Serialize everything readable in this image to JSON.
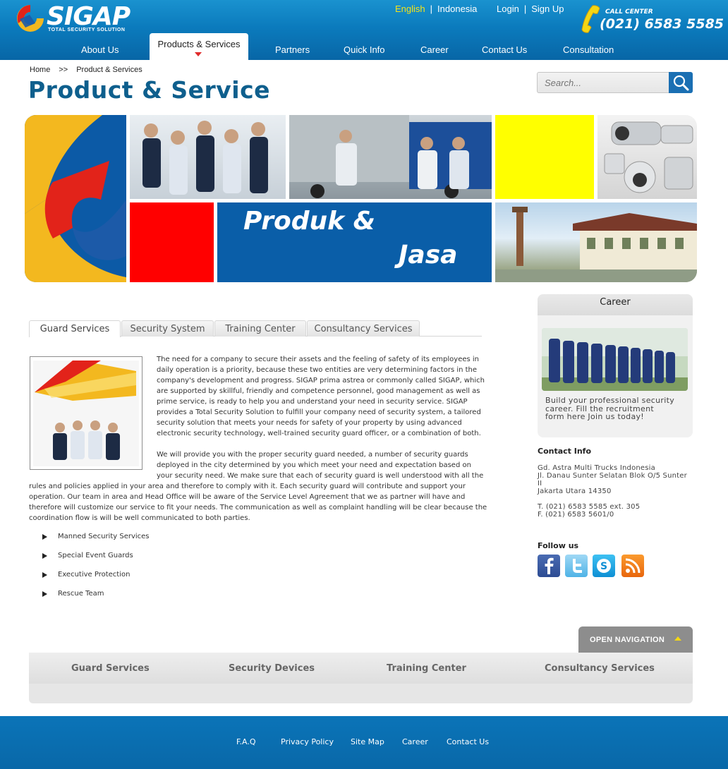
{
  "brand": {
    "name": "SIGAP",
    "tagline": "TOTAL SECURITY SOLUTION"
  },
  "header": {
    "languages": [
      "English",
      "Indonesia"
    ],
    "active_language": "English",
    "login": "Login",
    "signup": "Sign Up",
    "separator": "|",
    "callcenter_label": "CALL CENTER",
    "callcenter_number": "(021) 6583 5585"
  },
  "nav": {
    "items": [
      "About Us",
      "Products & Services",
      "Partners",
      "Quick Info",
      "Career",
      "Contact Us",
      "Consultation"
    ],
    "active": "Products & Services"
  },
  "breadcrumb": {
    "home": "Home",
    "sep": ">>",
    "current": "Product & Services"
  },
  "page_title": "Product & Service",
  "search": {
    "placeholder": "Search..."
  },
  "banner": {
    "line1": "Produk   &",
    "line2": "Jasa"
  },
  "tabs": [
    "Guard Services",
    "Security System",
    "Training Center",
    "Consultancy Services"
  ],
  "active_tab": "Guard Services",
  "content": {
    "p1": [
      "The need for a company to secure their assets and the feeling of safety of its employees in",
      "daily operation is a priority, because these two entities are very determining factors in the",
      "company's development and progress. SIGAP prima astrea or commonly called SIGAP, which",
      "are supported by skillful, friendly and competence personnel, good management as well as",
      "prime service, is ready to help you and understand your need in security service. SIGAP",
      "provides a Total Security Solution to fulfill your company need of security system, a tailored",
      "security solution that meets your needs for safety of your property by using advanced",
      "electronic security technology, well-trained security guard officer, or a combination of both."
    ],
    "p2_indented": [
      "We will provide you with the proper security guard needed, a number of security guards",
      "deployed in the city determined by you which meet your need and expectation based on",
      "your security need. We make sure that each of security guard is well understood with all the"
    ],
    "p2_full": [
      "rules and policies applied in your area and therefore to comply with it. Each security guard will contribute and support your",
      "operation. Our team in area and Head Office will be aware of the Service Level Agreement that we as partner will have and",
      "therefore will customize our service to fit your needs. The communication as well as complaint handling will be clear because the",
      "coordination flow is will be well communicated to both parties."
    ],
    "bullets": [
      "Manned Security Services",
      "Special Event Guards",
      "Executive Protection",
      "Rescue Team"
    ]
  },
  "sidebar": {
    "career_title": "Career",
    "career_caption": [
      "Build your professional security",
      "career. Fill the recruitment",
      "form here Join us today!"
    ],
    "contact_title": "Contact Info",
    "contact_lines": [
      "Gd. Astra Multi Trucks Indonesia",
      "Jl. Danau Sunter Selatan Blok O/5 Sunter",
      "II",
      "Jakarta Utara 14350"
    ],
    "phone": "T. (021) 6583 5585 ext. 305",
    "fax": "F. (021) 6583 5601/0",
    "follow_title": "Follow us",
    "social_icons": [
      "facebook-icon",
      "twitter-icon",
      "skype-icon",
      "rss-icon"
    ]
  },
  "bottom_nav": {
    "toggle_label": "OPEN NAVIGATION",
    "items": [
      "Guard Services",
      "Security Devices",
      "Training Center",
      "Consultancy Services"
    ]
  },
  "footer": {
    "links": [
      "F.A.Q",
      "Privacy Policy",
      "Site Map",
      "Career",
      "Contact Us"
    ]
  },
  "colors": {
    "header_blue": "#0b7bbd",
    "title_blue": "#0e5f8d",
    "accent_yellow": "#f4e318",
    "banner_red": "#e8201f",
    "banner_blue": "#0a5ea8"
  }
}
